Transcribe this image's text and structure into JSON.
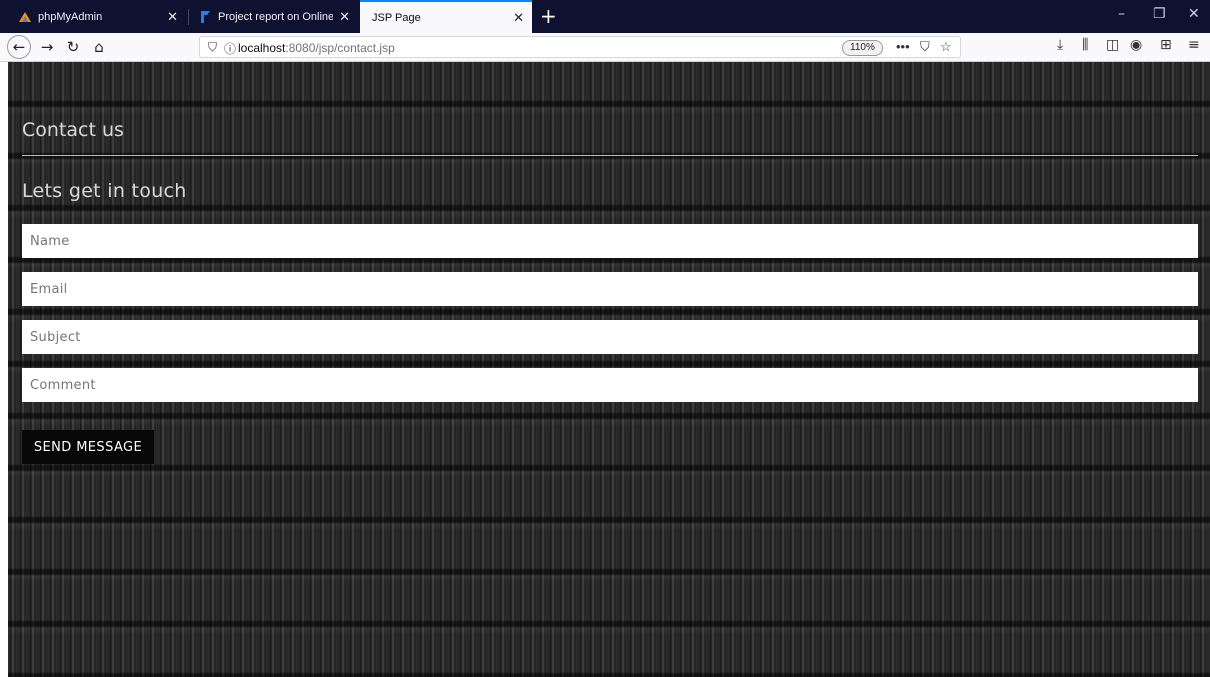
{
  "browser": {
    "tabs": [
      {
        "label": "phpMyAdmin",
        "icon": "phpmyadmin-favicon",
        "active": false
      },
      {
        "label": "Project report on Online Car R…",
        "icon": "project-favicon",
        "active": false
      },
      {
        "label": "JSP Page",
        "icon": "",
        "active": true
      }
    ],
    "new_tab_label": "+",
    "window_controls": {
      "minimize": "–",
      "restore": "❐",
      "close": "✕"
    },
    "url": {
      "host": "localhost",
      "rest": ":8080/jsp/contact.jsp"
    },
    "zoom": "110%",
    "url_actions": {
      "more": "•••",
      "pocket": "⛉",
      "bookmark": "☆"
    },
    "toolbar_icons": [
      "download-icon",
      "library-icon",
      "sidebar-icon",
      "account-icon",
      "extensions-icon",
      "menu-icon"
    ]
  },
  "page": {
    "contact_heading": "Contact us",
    "touch_heading": "Lets get in touch",
    "form": {
      "name_placeholder": "Name",
      "email_placeholder": "Email",
      "subject_placeholder": "Subject",
      "comment_placeholder": "Comment",
      "submit_label": "SEND MESSAGE"
    }
  },
  "colors": {
    "tabbar_bg": "#0f1130",
    "active_tab_accent": "#0a84ff",
    "heading_text": "#d9d9d9",
    "button_bg": "#070707"
  }
}
